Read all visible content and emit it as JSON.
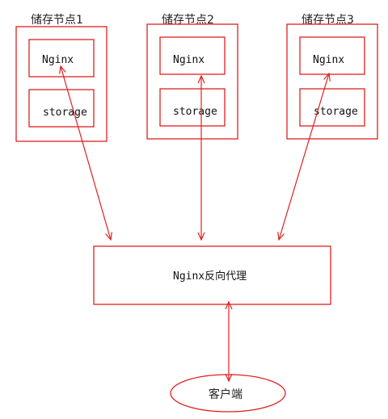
{
  "nodes": [
    {
      "title": "储存节点1",
      "nginx": "Nginx",
      "storage": "storage"
    },
    {
      "title": "储存节点2",
      "nginx": "Nginx",
      "storage": "storage"
    },
    {
      "title": "储存节点3",
      "nginx": "Nginx",
      "storage": "storage"
    }
  ],
  "proxy": {
    "label": "Nginx反向代理"
  },
  "client": {
    "label": "客户端"
  },
  "colors": {
    "line": "#e02020",
    "text": "#222222"
  }
}
